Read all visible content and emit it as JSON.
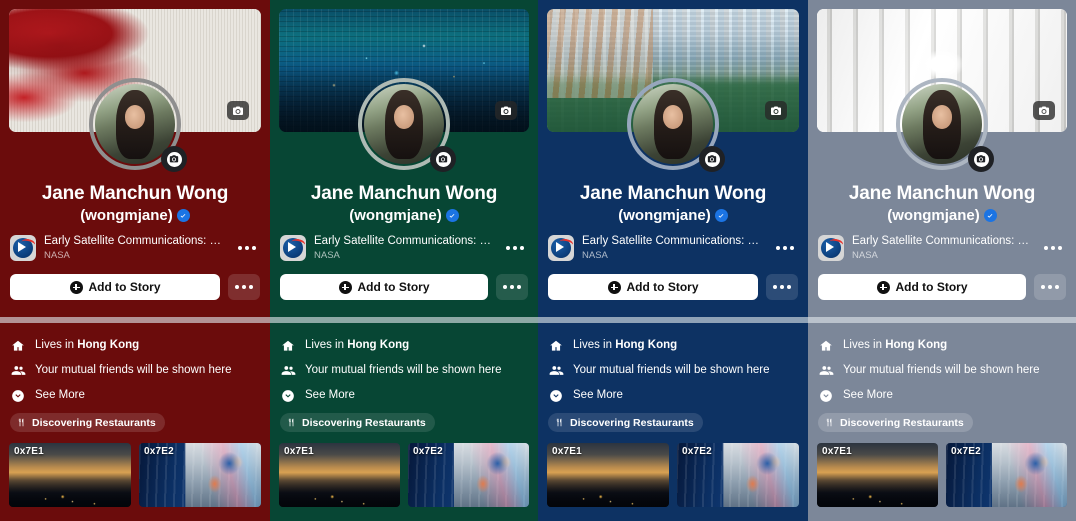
{
  "panels": [
    {
      "theme_name": "crimson",
      "bg_color": "#6B0C0C",
      "cover_photo_alt": "red-berry-wall",
      "profile": {
        "name": "Jane Manchun Wong",
        "handle": "(wongmjane)",
        "verified_icon": "verified-badge-icon",
        "avatar_alt": "profile-photo"
      },
      "now_playing": {
        "art_icon": "nasa-meatball-icon",
        "title": "Early Satellite Communications: Proj...",
        "subtitle": "NASA",
        "more_icon": "ellipsis-icon"
      },
      "story": {
        "label": "Add to Story",
        "plus_icon": "plus-circle-icon",
        "more_icon": "ellipsis-icon"
      },
      "info_rows": [
        {
          "icon": "home-icon",
          "prefix": "Lives in ",
          "strong": "Hong Kong"
        },
        {
          "icon": "friends-icon",
          "prefix": "Your mutual friends will be shown here",
          "strong": ""
        },
        {
          "icon": "chevron-down-circle-icon",
          "prefix": "See More",
          "strong": ""
        }
      ],
      "chip": {
        "icon": "cutlery-icon",
        "label": "Discovering Restaurants"
      },
      "photos": [
        {
          "label": "0x7E1",
          "alt": "city-sunset-photo"
        },
        {
          "label": "0x7E2",
          "alt": "billboard-street-photo"
        }
      ]
    },
    {
      "theme_name": "forest-green",
      "bg_color": "#074634",
      "cover_photo_alt": "hong-kong-night-skyline",
      "profile": {
        "name": "Jane Manchun Wong",
        "handle": "(wongmjane)",
        "verified_icon": "verified-badge-icon",
        "avatar_alt": "profile-photo"
      },
      "now_playing": {
        "art_icon": "nasa-meatball-icon",
        "title": "Early Satellite Communications: Proj...",
        "subtitle": "NASA",
        "more_icon": "ellipsis-icon"
      },
      "story": {
        "label": "Add to Story",
        "plus_icon": "plus-circle-icon",
        "more_icon": "ellipsis-icon"
      },
      "info_rows": [
        {
          "icon": "home-icon",
          "prefix": "Lives in ",
          "strong": "Hong Kong"
        },
        {
          "icon": "friends-icon",
          "prefix": "Your mutual friends will be shown here",
          "strong": ""
        },
        {
          "icon": "chevron-down-circle-icon",
          "prefix": "See More",
          "strong": ""
        }
      ],
      "chip": {
        "icon": "cutlery-icon",
        "label": "Discovering Restaurants"
      },
      "photos": [
        {
          "label": "0x7E1",
          "alt": "city-sunset-photo"
        },
        {
          "label": "0x7E2",
          "alt": "billboard-street-photo"
        }
      ]
    },
    {
      "theme_name": "navy-blue",
      "bg_color": "#0D3263",
      "cover_photo_alt": "hong-kong-daytime-skyline",
      "profile": {
        "name": "Jane Manchun Wong",
        "handle": "(wongmjane)",
        "verified_icon": "verified-badge-icon",
        "avatar_alt": "profile-photo"
      },
      "now_playing": {
        "art_icon": "nasa-meatball-icon",
        "title": "Early Satellite Communications: Proj...",
        "subtitle": "NASA",
        "more_icon": "ellipsis-icon"
      },
      "story": {
        "label": "Add to Story",
        "plus_icon": "plus-circle-icon",
        "more_icon": "ellipsis-icon"
      },
      "info_rows": [
        {
          "icon": "home-icon",
          "prefix": "Lives in ",
          "strong": "Hong Kong"
        },
        {
          "icon": "friends-icon",
          "prefix": "Your mutual friends will be shown here",
          "strong": ""
        },
        {
          "icon": "chevron-down-circle-icon",
          "prefix": "See More",
          "strong": ""
        }
      ],
      "chip": {
        "icon": "cutlery-icon",
        "label": "Discovering Restaurants"
      },
      "photos": [
        {
          "label": "0x7E1",
          "alt": "city-sunset-photo"
        },
        {
          "label": "0x7E2",
          "alt": "billboard-street-photo"
        }
      ]
    },
    {
      "theme_name": "slate-gray",
      "bg_color": "#7C8799",
      "cover_photo_alt": "white-architecture",
      "profile": {
        "name": "Jane Manchun Wong",
        "handle": "(wongmjane)",
        "verified_icon": "verified-badge-icon",
        "avatar_alt": "profile-photo"
      },
      "now_playing": {
        "art_icon": "nasa-meatball-icon",
        "title": "Early Satellite Communications: Proj...",
        "subtitle": "NASA",
        "more_icon": "ellipsis-icon"
      },
      "story": {
        "label": "Add to Story",
        "plus_icon": "plus-circle-icon",
        "more_icon": "ellipsis-icon"
      },
      "info_rows": [
        {
          "icon": "home-icon",
          "prefix": "Lives in ",
          "strong": "Hong Kong"
        },
        {
          "icon": "friends-icon",
          "prefix": "Your mutual friends will be shown here",
          "strong": ""
        },
        {
          "icon": "chevron-down-circle-icon",
          "prefix": "See More",
          "strong": ""
        }
      ],
      "chip": {
        "icon": "cutlery-icon",
        "label": "Discovering Restaurants"
      },
      "photos": [
        {
          "label": "0x7E1",
          "alt": "city-sunset-photo"
        },
        {
          "label": "0x7E2",
          "alt": "billboard-street-photo"
        }
      ]
    }
  ],
  "colors": {
    "verified_blue": "#1B74E4",
    "story_button_bg": "#FFFFFF",
    "divider": "#E1E6EC"
  }
}
